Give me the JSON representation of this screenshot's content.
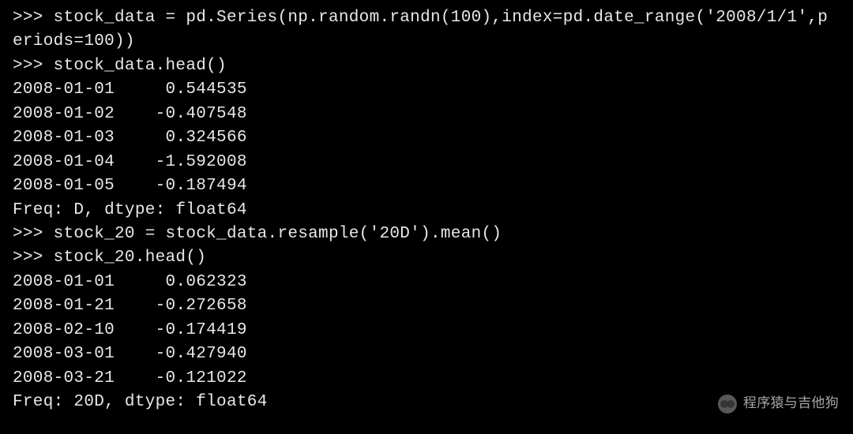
{
  "terminal": {
    "prompt": ">>> ",
    "commands": {
      "cmd1_part1": "stock_data = pd.Series(np.random.randn(100),index=pd.date_range('2008/1/1',p",
      "cmd1_part2": "eriods=100))",
      "cmd2": "stock_data.head()",
      "cmd3": "stock_20 = stock_data.resample('20D').mean()",
      "cmd4": "stock_20.head()"
    },
    "output1": {
      "rows": [
        {
          "date": "2008-01-01",
          "value": " 0.544535"
        },
        {
          "date": "2008-01-02",
          "value": "-0.407548"
        },
        {
          "date": "2008-01-03",
          "value": " 0.324566"
        },
        {
          "date": "2008-01-04",
          "value": "-1.592008"
        },
        {
          "date": "2008-01-05",
          "value": "-0.187494"
        }
      ],
      "footer": "Freq: D, dtype: float64"
    },
    "output2": {
      "rows": [
        {
          "date": "2008-01-01",
          "value": " 0.062323"
        },
        {
          "date": "2008-01-21",
          "value": "-0.272658"
        },
        {
          "date": "2008-02-10",
          "value": "-0.174419"
        },
        {
          "date": "2008-03-01",
          "value": "-0.427940"
        },
        {
          "date": "2008-03-21",
          "value": "-0.121022"
        }
      ],
      "footer": "Freq: 20D, dtype: float64"
    }
  },
  "watermark": {
    "text": "程序猿与吉他狗"
  }
}
